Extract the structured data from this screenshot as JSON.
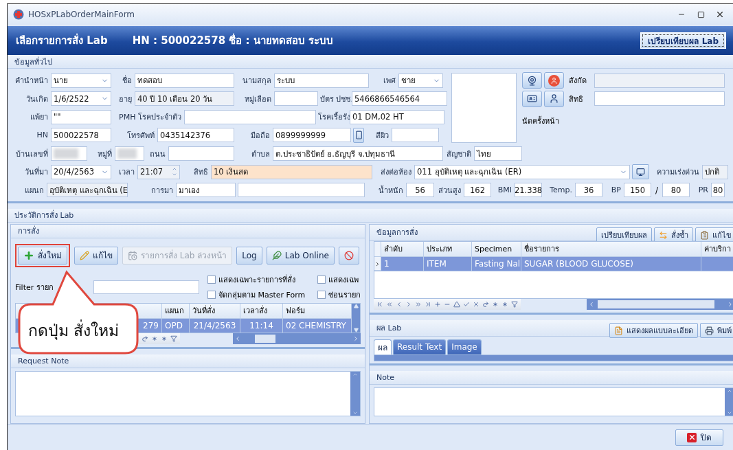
{
  "window": {
    "title": "HOSxPLabOrderMainForm"
  },
  "header": {
    "title": "เลือกรายการสั่ง Lab",
    "patient": "HN : 500022578 ชื่อ : นายทดสอบ ระบบ",
    "compare_button": "เปรียบเทียบผล Lab"
  },
  "general": {
    "title": "ข้อมูลทั่วไป",
    "rows": [
      [
        {
          "label": "คำนำหน้า",
          "value": "นาย",
          "kind": "combo"
        },
        {
          "label": "ชื่อ",
          "value": "ทดสอบ",
          "kind": "text"
        },
        {
          "label": "นามสกุล",
          "value": "ระบบ",
          "kind": "text"
        },
        {
          "label": "เพศ",
          "value": "ชาย",
          "kind": "combo"
        }
      ],
      [
        {
          "label": "วันเกิด",
          "value": "1/6/2522",
          "kind": "combo"
        },
        {
          "label": "อายุ",
          "value": "40 ปี 10 เดือน 20 วัน",
          "kind": "readonly"
        },
        {
          "label": "หมู่เลือด",
          "kind": "text"
        },
        {
          "label": "บัตร ปชช.",
          "value": "5466866546564",
          "kind": "text"
        }
      ],
      [
        {
          "label": "แพ้ยา",
          "value": "\"\"",
          "kind": "text"
        },
        {
          "label": "PMH โรคประจำตัว",
          "kind": "text"
        },
        {
          "label": "โรคเรื้อรัง",
          "value": "01 DM,02 HT",
          "kind": "text"
        }
      ],
      [
        {
          "label": "HN",
          "value": "500022578",
          "kind": "text"
        },
        {
          "label": "โทรศัพท์",
          "value": "0435142376",
          "kind": "text"
        },
        {
          "label": "มือถือ",
          "value": "0899999999",
          "kind": "text"
        },
        {
          "kind": "button"
        },
        {
          "label": "สีผิว",
          "kind": "text"
        }
      ]
    ],
    "side_rows": [
      {
        "label": "สังกัด",
        "kind": "readonly"
      },
      {
        "label": "สิทธิ",
        "kind": "text"
      }
    ],
    "next_appointment": "นัดครั้งหน้า",
    "lower_rows": [
      [
        {
          "label": "บ้านเลขที่",
          "kind": "redacted"
        },
        {
          "label": "หมู่ที่",
          "kind": "redacted"
        },
        {
          "label": "ถนน",
          "kind": "text"
        },
        {
          "label": "ตำบล",
          "value": "ต.ประชาธิปัตย์ อ.ธัญบุรี จ.ปทุมธานี",
          "kind": "text"
        },
        {
          "label": "สัญชาติ",
          "value": "ไทย",
          "kind": "text"
        }
      ],
      [
        {
          "label": "วันที่มา",
          "value": "20/4/2563",
          "kind": "combo"
        },
        {
          "label": "เวลา",
          "value": "21:07",
          "kind": "spin"
        },
        {
          "label": "สิทธิ",
          "value": "10 เงินสด",
          "kind": "notice"
        },
        {
          "label": "ส่งต่อห้อง",
          "value": "011 อุบัติเหตุ และฉุกเฉิน (ER)",
          "kind": "combo"
        },
        {
          "kind": "button"
        },
        {
          "label": "ความเร่งด่วน",
          "value": "ปกติ",
          "kind": "readonly"
        }
      ],
      [
        {
          "label": "แผนก",
          "value": "อุบัติเหตุ และฉุกเฉิน (E",
          "kind": "readonly"
        },
        {
          "label": "การมา",
          "value": "มาเอง",
          "kind": "text"
        },
        {
          "kind": "text"
        },
        {
          "label": "น้ำหนัก",
          "value": "56",
          "kind": "number"
        },
        {
          "label": "ส่วนสูง",
          "value": "162",
          "kind": "number"
        },
        {
          "label": "BMI",
          "value": "21.338",
          "kind": "number"
        },
        {
          "label": "Temp.",
          "value": "36",
          "kind": "number"
        },
        {
          "label": "BP",
          "value": "150",
          "kind": "number"
        },
        {
          "label": "/",
          "kind": "slash"
        },
        {
          "value": "80",
          "kind": "number"
        },
        {
          "label": "PR",
          "value": "80",
          "kind": "number"
        }
      ]
    ]
  },
  "history_title": "ประวัติการสั่ง Lab",
  "orders": {
    "title": "การสั่ง",
    "toolbar": [
      {
        "label": "สั่งใหม่",
        "kind": "new",
        "disabled": false,
        "highlighted": true
      },
      {
        "label": "แก้ไข",
        "kind": "edit",
        "disabled": false,
        "highlighted": false
      },
      {
        "label": "รายการสั่ง Lab ล่วงหน้า",
        "kind": "advance",
        "disabled": true,
        "highlighted": false
      },
      {
        "label": "Log",
        "kind": "log",
        "disabled": false,
        "highlighted": false
      },
      {
        "label": "Lab Online",
        "kind": "online",
        "disabled": false,
        "highlighted": false
      },
      {
        "kind": "stop",
        "disabled": false,
        "highlighted": false
      }
    ],
    "filter_label": "Filter รายก",
    "options": [
      {
        "label": "แสดงเฉพาะรายการที่สั่ง",
        "checked": false
      },
      {
        "label": "แสดงเฉพ",
        "checked": false
      },
      {
        "label": "จัดกลุ่มตาม Master Form",
        "checked": false
      },
      {
        "label": "ซ่อนรายก",
        "checked": false
      }
    ],
    "table": {
      "columns": [
        "",
        "แผนก",
        "วันที่สั่ง",
        "เวลาสั่ง",
        "ฟอร์ม"
      ],
      "rows": [
        {
          "selected": true,
          "cells": [
            "279",
            "OPD",
            "21/4/2563",
            "11:14",
            "02 CHEMISTRY"
          ]
        }
      ]
    },
    "callout": "กดปุ่ม สั่งใหม่",
    "request_note_title": "Request Note"
  },
  "order_details": {
    "title": "ข้อมูลการสั่ง",
    "buttons": [
      {
        "label": "เปรียบเทียบผล",
        "kind": "compare"
      },
      {
        "label": "สั่งซ้ำ",
        "kind": "repeat"
      },
      {
        "label": "แก้ไข",
        "kind": "edit"
      }
    ],
    "table": {
      "columns": [
        "ลำดับ",
        "ประเภท",
        "Specimen",
        "ชื่อรายการ",
        "ค่าบริกา"
      ],
      "rows": [
        {
          "selected": true,
          "cells": [
            "1",
            "ITEM",
            "Fasting Nal",
            "SUGAR (BLOOD GLUCOSE)"
          ]
        }
      ]
    }
  },
  "results": {
    "title": "ผล Lab",
    "buttons": [
      {
        "label": "แสดงผลแบบละเอียด",
        "kind": "detail"
      },
      {
        "label": "พิมพ์",
        "kind": "print"
      }
    ],
    "tabs": [
      {
        "label": "ผล",
        "selected": true
      },
      {
        "label": "Result Text",
        "selected": false
      },
      {
        "label": "Image",
        "selected": false
      }
    ]
  },
  "note_title": "Note",
  "close_button": "ปิด"
}
